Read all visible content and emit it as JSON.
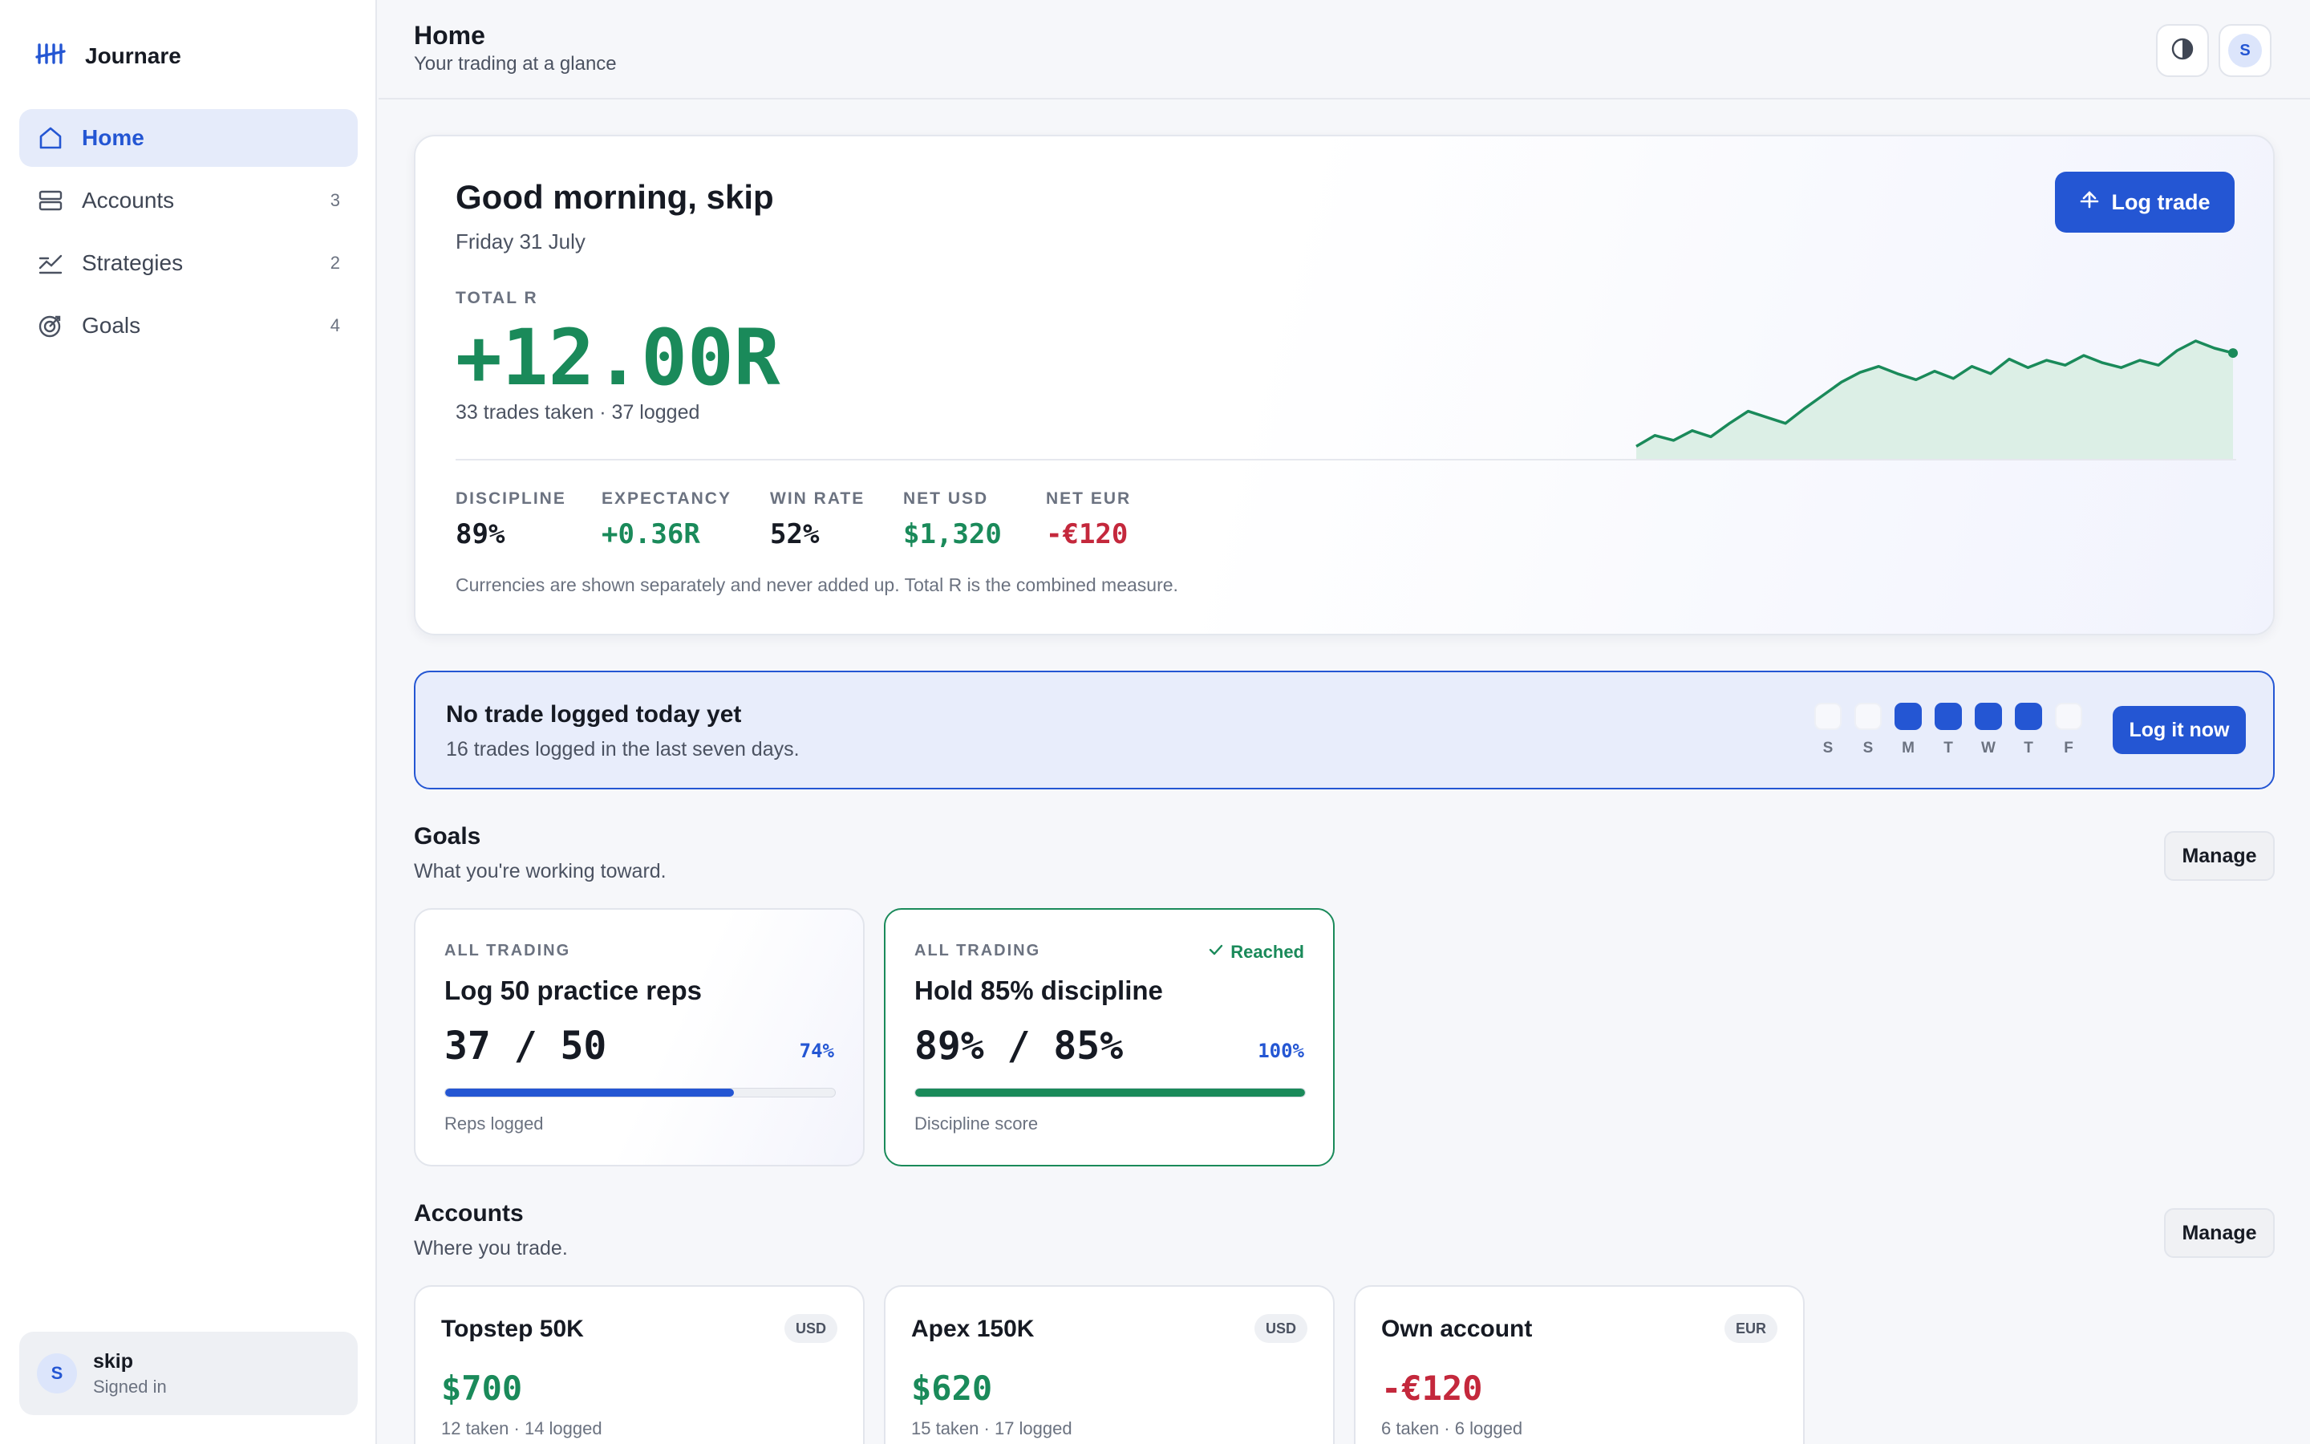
{
  "app": {
    "name": "Journare"
  },
  "sidebar": {
    "items": [
      {
        "label": "Home",
        "count": "",
        "icon": "home-icon"
      },
      {
        "label": "Accounts",
        "count": "3",
        "icon": "accounts-icon"
      },
      {
        "label": "Strategies",
        "count": "2",
        "icon": "strategies-icon"
      },
      {
        "label": "Goals",
        "count": "4",
        "icon": "goals-icon"
      }
    ],
    "user": {
      "initial": "S",
      "name": "skip",
      "status": "Signed in"
    }
  },
  "header": {
    "title": "Home",
    "subtitle": "Your trading at a glance",
    "avatar_initial": "S"
  },
  "hero": {
    "greeting": "Good morning, skip",
    "date": "Friday 31 July",
    "total_label": "TOTAL R",
    "total_value": "+12.00R",
    "trades_line": "33 trades taken · 37 logged",
    "log_trade_label": "Log trade",
    "stats": [
      {
        "label": "DISCIPLINE",
        "value": "89%",
        "tone": "neutral"
      },
      {
        "label": "EXPECTANCY",
        "value": "+0.36R",
        "tone": "pos"
      },
      {
        "label": "WIN RATE",
        "value": "52%",
        "tone": "neutral"
      },
      {
        "label": "NET USD",
        "value": "$1,320",
        "tone": "pos"
      },
      {
        "label": "NET EUR",
        "value": "-€120",
        "tone": "neg"
      }
    ],
    "note": "Currencies are shown separately and never added up. Total R is the combined measure.",
    "sparkline": [
      0.5,
      1.4,
      1.0,
      1.8,
      1.3,
      2.4,
      3.4,
      2.9,
      2.4,
      3.6,
      4.7,
      5.8,
      6.6,
      7.1,
      6.5,
      6.0,
      6.7,
      6.1,
      7.1,
      6.5,
      7.7,
      7.0,
      7.6,
      7.2,
      8.0,
      7.4,
      7.0,
      7.6,
      7.2,
      8.4,
      9.2,
      8.6,
      8.2
    ]
  },
  "banner": {
    "title": "No trade logged today yet",
    "subtitle": "16 trades logged in the last seven days.",
    "days": [
      {
        "letter": "S",
        "logged": false
      },
      {
        "letter": "S",
        "logged": false
      },
      {
        "letter": "M",
        "logged": true
      },
      {
        "letter": "T",
        "logged": true
      },
      {
        "letter": "W",
        "logged": true
      },
      {
        "letter": "T",
        "logged": true
      },
      {
        "letter": "F",
        "logged": false
      }
    ],
    "button_label": "Log it now"
  },
  "goals": {
    "title": "Goals",
    "subtitle": "What you're working toward.",
    "manage_label": "Manage",
    "cards": [
      {
        "tag": "ALL TRADING",
        "title": "Log 50 practice reps",
        "progress_text": "37 / 50",
        "pct": "74%",
        "fraction": 0.74,
        "caption": "Reps logged",
        "reached": false,
        "reached_label": ""
      },
      {
        "tag": "ALL TRADING",
        "title": "Hold 85% discipline",
        "progress_text": "89% / 85%",
        "pct": "100%",
        "fraction": 1.0,
        "caption": "Discipline score",
        "reached": true,
        "reached_label": "Reached"
      }
    ]
  },
  "accounts": {
    "title": "Accounts",
    "subtitle": "Where you trade.",
    "manage_label": "Manage",
    "cards": [
      {
        "name": "Topstep 50K",
        "currency": "USD",
        "net": "$700",
        "tone": "pos",
        "line": "12 taken · 14 logged"
      },
      {
        "name": "Apex 150K",
        "currency": "USD",
        "net": "$620",
        "tone": "pos",
        "line": "15 taken · 17 logged"
      },
      {
        "name": "Own account",
        "currency": "EUR",
        "net": "-€120",
        "tone": "neg",
        "line": "6 taken · 6 logged"
      }
    ]
  },
  "colors": {
    "accent": "#2456d3",
    "positive": "#1a8a5a",
    "negative": "#c4283c"
  }
}
